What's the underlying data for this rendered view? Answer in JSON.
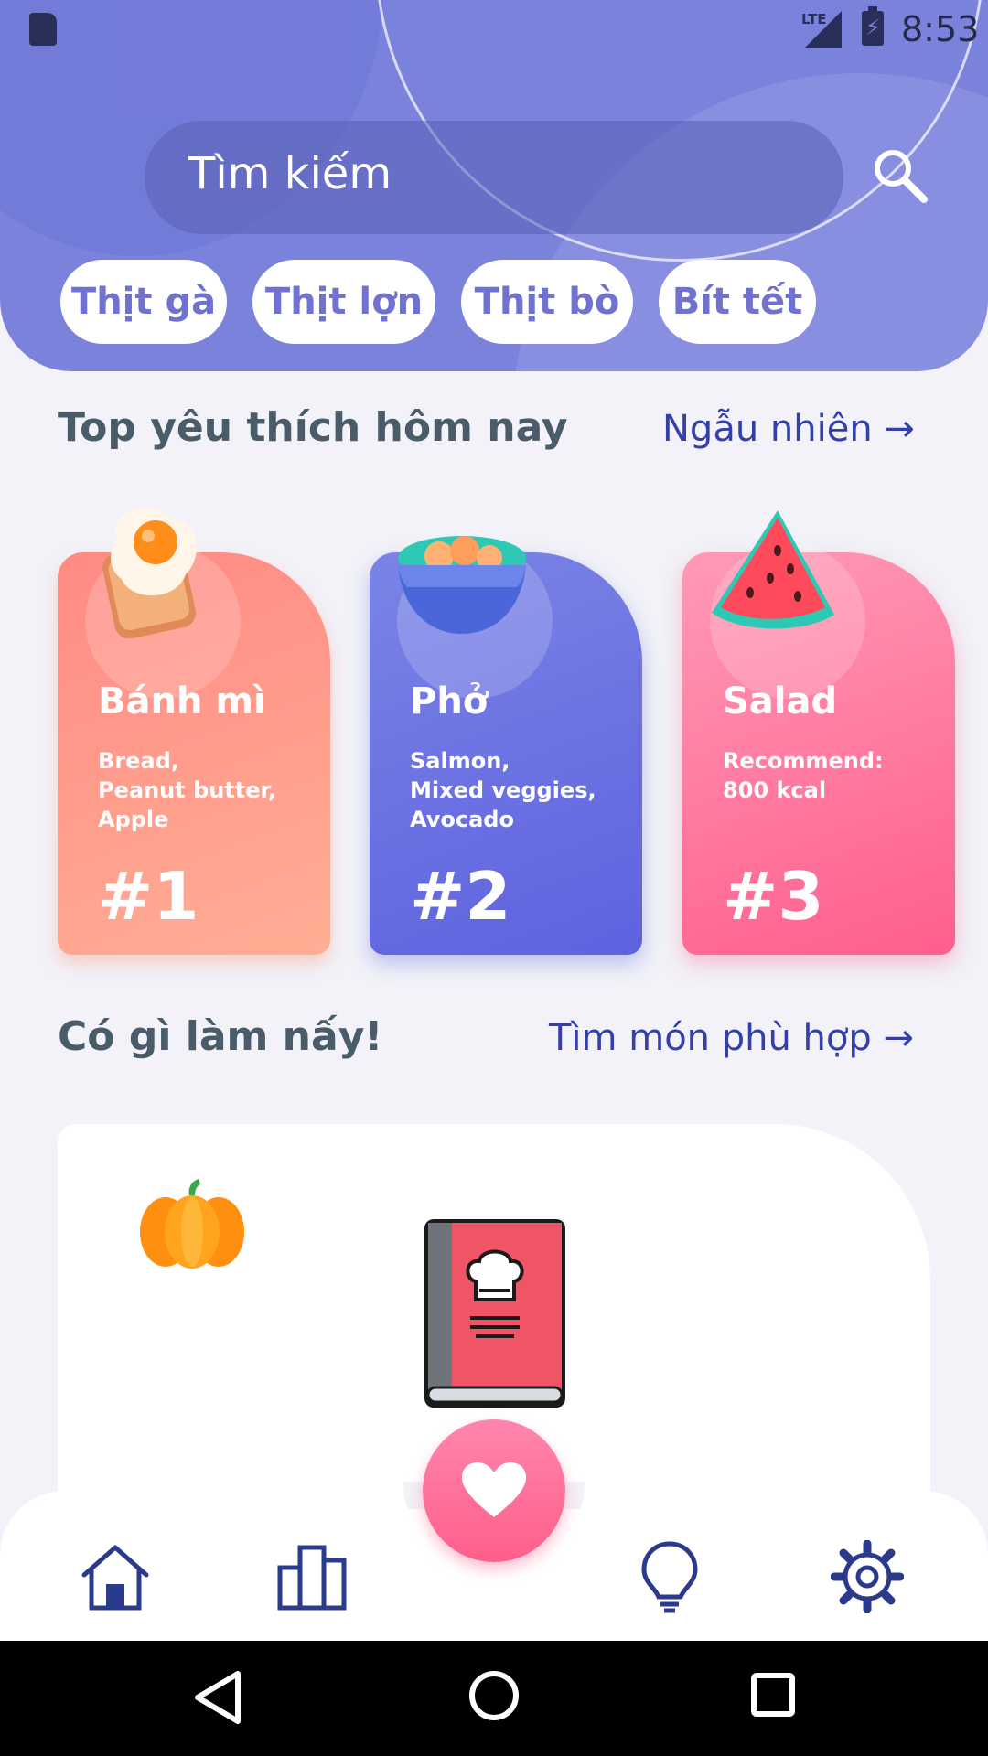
{
  "status_bar": {
    "time": "8:53",
    "network": "LTE"
  },
  "search": {
    "placeholder": "Tìm kiếm"
  },
  "chips": [
    "Thịt gà",
    "Thịt lợn",
    "Thịt bò",
    "Bít tết"
  ],
  "section1": {
    "title": "Top yêu thích hôm nay",
    "link": "Ngẫu nhiên →"
  },
  "cards": [
    {
      "name": "Bánh mì",
      "desc": "Bread,\nPeanut butter,\nApple",
      "rank": "#1",
      "icon": "egg-toast-icon"
    },
    {
      "name": "Phở",
      "desc": "Salmon,\nMixed veggies,\nAvocado",
      "rank": "#2",
      "icon": "bowl-icon"
    },
    {
      "name": "Salad",
      "desc": "Recommend:\n800 kcal",
      "rank": "#3",
      "icon": "watermelon-icon"
    }
  ],
  "section2": {
    "title": "Có gì làm nấy!",
    "link": "Tìm món phù hợp →"
  },
  "nav": {
    "items": [
      "home-icon",
      "stats-icon",
      "favorites-fab",
      "bulb-icon",
      "settings-icon"
    ]
  },
  "colors": {
    "header": "#7b82dc",
    "accent": "#3340a8",
    "fab": "#ff6f96"
  }
}
